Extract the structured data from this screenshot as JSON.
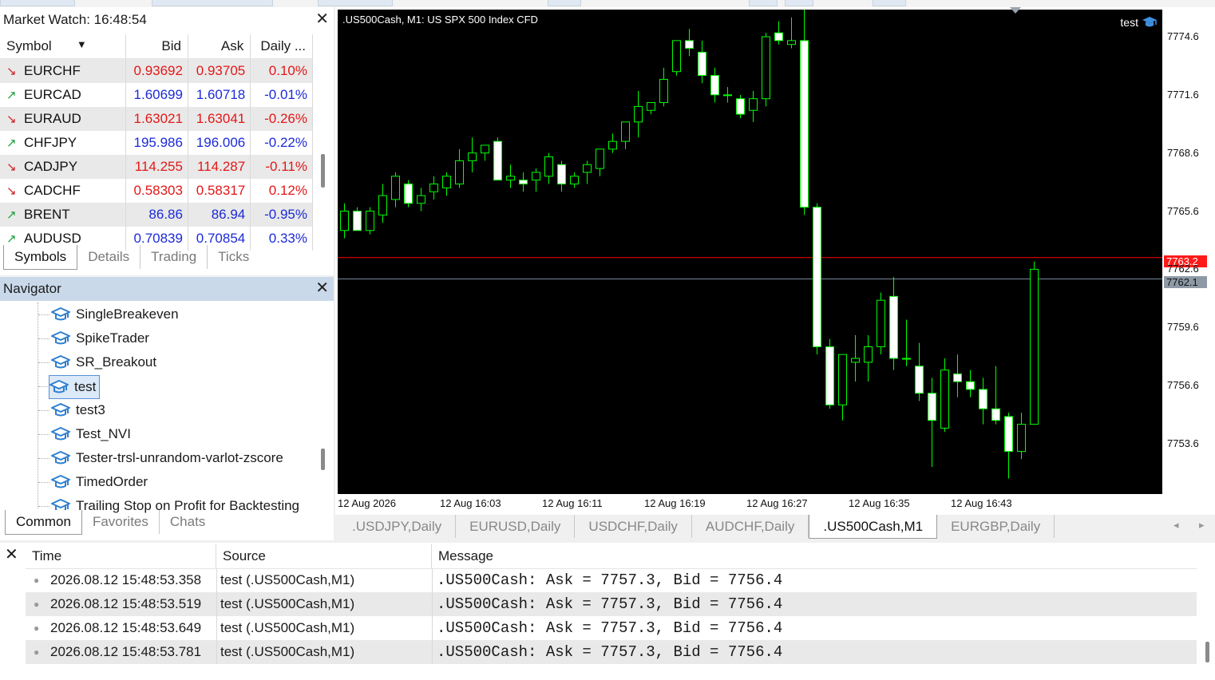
{
  "market_watch": {
    "title": "Market Watch: 16:48:54",
    "columns": {
      "symbol": "Symbol",
      "bid": "Bid",
      "ask": "Ask",
      "daily": "Daily ..."
    },
    "rows": [
      {
        "symbol": "EURCHF",
        "direction": "down",
        "bid": "0.93692",
        "ask": "0.93705",
        "daily": "0.10%",
        "color": "red"
      },
      {
        "symbol": "EURCAD",
        "direction": "up",
        "bid": "1.60699",
        "ask": "1.60718",
        "daily": "-0.01%",
        "color": "blue"
      },
      {
        "symbol": "EURAUD",
        "direction": "down",
        "bid": "1.63021",
        "ask": "1.63041",
        "daily": "-0.26%",
        "color": "red"
      },
      {
        "symbol": "CHFJPY",
        "direction": "up",
        "bid": "195.986",
        "ask": "196.006",
        "daily": "-0.22%",
        "color": "blue"
      },
      {
        "symbol": "CADJPY",
        "direction": "down",
        "bid": "114.255",
        "ask": "114.287",
        "daily": "-0.11%",
        "color": "red"
      },
      {
        "symbol": "CADCHF",
        "direction": "down",
        "bid": "0.58303",
        "ask": "0.58317",
        "daily": "0.12%",
        "color": "red"
      },
      {
        "symbol": "BRENT",
        "direction": "up",
        "bid": "86.86",
        "ask": "86.94",
        "daily": "-0.95%",
        "color": "blue"
      },
      {
        "symbol": "AUDUSD",
        "direction": "up",
        "bid": "0.70839",
        "ask": "0.70854",
        "daily": "0.33%",
        "color": "blue"
      }
    ],
    "tabs": [
      "Symbols",
      "Details",
      "Trading",
      "Ticks"
    ]
  },
  "navigator": {
    "title": "Navigator",
    "items": [
      "SingleBreakeven",
      "SpikeTrader",
      "SR_Breakout",
      "test",
      "test3",
      "Test_NVI",
      "Tester-trsl-unrandom-varlot-zscore",
      "TimedOrder",
      "Trailing Stop on Profit for Backtesting"
    ],
    "selected": "test",
    "tabs": [
      "Common",
      "Favorites",
      "Chats"
    ]
  },
  "chart": {
    "title": ".US500Cash, M1:  US SPX 500 Index CFD",
    "ea_name": "test",
    "price_labels": [
      "7774.6",
      "7771.6",
      "7768.6",
      "7765.6",
      "7762.6",
      "7759.6",
      "7756.6",
      "7753.6"
    ],
    "ask_price": "7763.2",
    "bid_price": "7762.1",
    "time_labels": [
      "12 Aug 2026",
      "12 Aug 16:03",
      "12 Aug 16:11",
      "12 Aug 16:19",
      "12 Aug 16:27",
      "12 Aug 16:35",
      "12 Aug 16:43"
    ],
    "colors": {
      "background": "#000000",
      "candle": "#00ff00",
      "ask_line": "#ff0000",
      "bid_line": "#778899"
    }
  },
  "chart_data": {
    "type": "candlestick",
    "ylim": [
      7751.0,
      7777.0
    ],
    "candles": [
      {
        "o": 7764.6,
        "h": 7766.0,
        "l": 7764.2,
        "c": 7765.6
      },
      {
        "o": 7765.6,
        "h": 7765.8,
        "l": 7764.6,
        "c": 7764.6
      },
      {
        "o": 7764.6,
        "h": 7765.8,
        "l": 7764.4,
        "c": 7765.6
      },
      {
        "o": 7765.4,
        "h": 7767.0,
        "l": 7765.0,
        "c": 7766.4
      },
      {
        "o": 7766.2,
        "h": 7767.6,
        "l": 7765.8,
        "c": 7767.4
      },
      {
        "o": 7767.0,
        "h": 7767.2,
        "l": 7765.8,
        "c": 7766.0
      },
      {
        "o": 7766.0,
        "h": 7766.8,
        "l": 7765.6,
        "c": 7766.4
      },
      {
        "o": 7766.6,
        "h": 7767.4,
        "l": 7766.2,
        "c": 7767.0
      },
      {
        "o": 7766.8,
        "h": 7767.6,
        "l": 7766.4,
        "c": 7767.4
      },
      {
        "o": 7767.0,
        "h": 7768.8,
        "l": 7766.8,
        "c": 7768.2
      },
      {
        "o": 7768.2,
        "h": 7769.4,
        "l": 7767.6,
        "c": 7768.6
      },
      {
        "o": 7768.6,
        "h": 7769.0,
        "l": 7768.2,
        "c": 7769.0
      },
      {
        "o": 7769.2,
        "h": 7769.4,
        "l": 7767.4,
        "c": 7767.2
      },
      {
        "o": 7767.2,
        "h": 7768.0,
        "l": 7766.8,
        "c": 7767.4
      },
      {
        "o": 7767.2,
        "h": 7767.6,
        "l": 7766.6,
        "c": 7767.0
      },
      {
        "o": 7767.2,
        "h": 7767.8,
        "l": 7766.6,
        "c": 7767.6
      },
      {
        "o": 7767.4,
        "h": 7768.6,
        "l": 7767.0,
        "c": 7768.4
      },
      {
        "o": 7768.0,
        "h": 7768.2,
        "l": 7766.6,
        "c": 7767.0
      },
      {
        "o": 7767.0,
        "h": 7767.6,
        "l": 7766.8,
        "c": 7767.4
      },
      {
        "o": 7767.6,
        "h": 7768.2,
        "l": 7767.0,
        "c": 7768.0
      },
      {
        "o": 7767.8,
        "h": 7768.8,
        "l": 7767.4,
        "c": 7768.8
      },
      {
        "o": 7768.8,
        "h": 7769.6,
        "l": 7768.6,
        "c": 7769.2
      },
      {
        "o": 7769.2,
        "h": 7770.0,
        "l": 7768.8,
        "c": 7770.2
      },
      {
        "o": 7770.2,
        "h": 7771.8,
        "l": 7769.4,
        "c": 7771.0
      },
      {
        "o": 7770.8,
        "h": 7771.2,
        "l": 7770.6,
        "c": 7771.2
      },
      {
        "o": 7771.2,
        "h": 7773.0,
        "l": 7771.0,
        "c": 7772.4
      },
      {
        "o": 7772.8,
        "h": 7774.4,
        "l": 7772.6,
        "c": 7774.4
      },
      {
        "o": 7774.4,
        "h": 7775.0,
        "l": 7773.6,
        "c": 7774.0
      },
      {
        "o": 7773.8,
        "h": 7774.4,
        "l": 7772.2,
        "c": 7772.6
      },
      {
        "o": 7772.6,
        "h": 7773.0,
        "l": 7771.2,
        "c": 7771.6
      },
      {
        "o": 7771.6,
        "h": 7772.0,
        "l": 7771.2,
        "c": 7771.6
      },
      {
        "o": 7771.4,
        "h": 7771.6,
        "l": 7770.4,
        "c": 7770.6
      },
      {
        "o": 7770.8,
        "h": 7771.8,
        "l": 7770.2,
        "c": 7771.4
      },
      {
        "o": 7771.4,
        "h": 7774.8,
        "l": 7771.0,
        "c": 7774.6
      },
      {
        "o": 7774.8,
        "h": 7775.4,
        "l": 7774.2,
        "c": 7774.4
      },
      {
        "o": 7774.2,
        "h": 7775.6,
        "l": 7774.0,
        "c": 7774.4
      },
      {
        "o": 7774.4,
        "h": 7776.8,
        "l": 7765.4,
        "c": 7765.8
      },
      {
        "o": 7765.8,
        "h": 7766.0,
        "l": 7758.2,
        "c": 7758.6
      },
      {
        "o": 7758.6,
        "h": 7759.0,
        "l": 7755.4,
        "c": 7755.6
      },
      {
        "o": 7755.6,
        "h": 7758.0,
        "l": 7754.8,
        "c": 7758.2
      },
      {
        "o": 7757.8,
        "h": 7759.2,
        "l": 7756.8,
        "c": 7758.0
      },
      {
        "o": 7757.8,
        "h": 7759.2,
        "l": 7756.8,
        "c": 7758.6
      },
      {
        "o": 7758.6,
        "h": 7761.4,
        "l": 7758.2,
        "c": 7761.0
      },
      {
        "o": 7761.2,
        "h": 7762.2,
        "l": 7757.4,
        "c": 7758.0
      },
      {
        "o": 7758.0,
        "h": 7760.0,
        "l": 7757.6,
        "c": 7758.0
      },
      {
        "o": 7757.6,
        "h": 7758.8,
        "l": 7755.8,
        "c": 7756.2
      },
      {
        "o": 7756.2,
        "h": 7757.0,
        "l": 7752.4,
        "c": 7754.8
      },
      {
        "o": 7754.4,
        "h": 7758.0,
        "l": 7754.2,
        "c": 7757.4
      },
      {
        "o": 7757.2,
        "h": 7758.2,
        "l": 7756.0,
        "c": 7756.8
      },
      {
        "o": 7756.8,
        "h": 7757.4,
        "l": 7756.0,
        "c": 7756.4
      },
      {
        "o": 7756.4,
        "h": 7757.0,
        "l": 7754.6,
        "c": 7755.4
      },
      {
        "o": 7755.4,
        "h": 7757.6,
        "l": 7754.6,
        "c": 7754.8
      },
      {
        "o": 7755.0,
        "h": 7755.2,
        "l": 7751.8,
        "c": 7753.2
      },
      {
        "o": 7753.2,
        "h": 7755.2,
        "l": 7752.8,
        "c": 7754.6
      },
      {
        "o": 7754.6,
        "h": 7763.0,
        "l": 7754.6,
        "c": 7762.6
      }
    ]
  },
  "chart_tabs": [
    ".USDJPY,Daily",
    "EURUSD,Daily",
    "USDCHF,Daily",
    "AUDCHF,Daily",
    ".US500Cash,M1",
    "EURGBP,Daily"
  ],
  "active_chart_tab": ".US500Cash,M1",
  "journal": {
    "columns": {
      "time": "Time",
      "source": "Source",
      "message": "Message"
    },
    "rows": [
      {
        "time": "2026.08.12 15:48:53.358",
        "source": "test (.US500Cash,M1)",
        "message": ".US500Cash: Ask = 7757.3, Bid = 7756.4"
      },
      {
        "time": "2026.08.12 15:48:53.519",
        "source": "test (.US500Cash,M1)",
        "message": ".US500Cash: Ask = 7757.3, Bid = 7756.4"
      },
      {
        "time": "2026.08.12 15:48:53.649",
        "source": "test (.US500Cash,M1)",
        "message": ".US500Cash: Ask = 7757.3, Bid = 7756.4"
      },
      {
        "time": "2026.08.12 15:48:53.781",
        "source": "test (.US500Cash,M1)",
        "message": ".US500Cash: Ask = 7757.3, Bid = 7756.4"
      }
    ]
  }
}
